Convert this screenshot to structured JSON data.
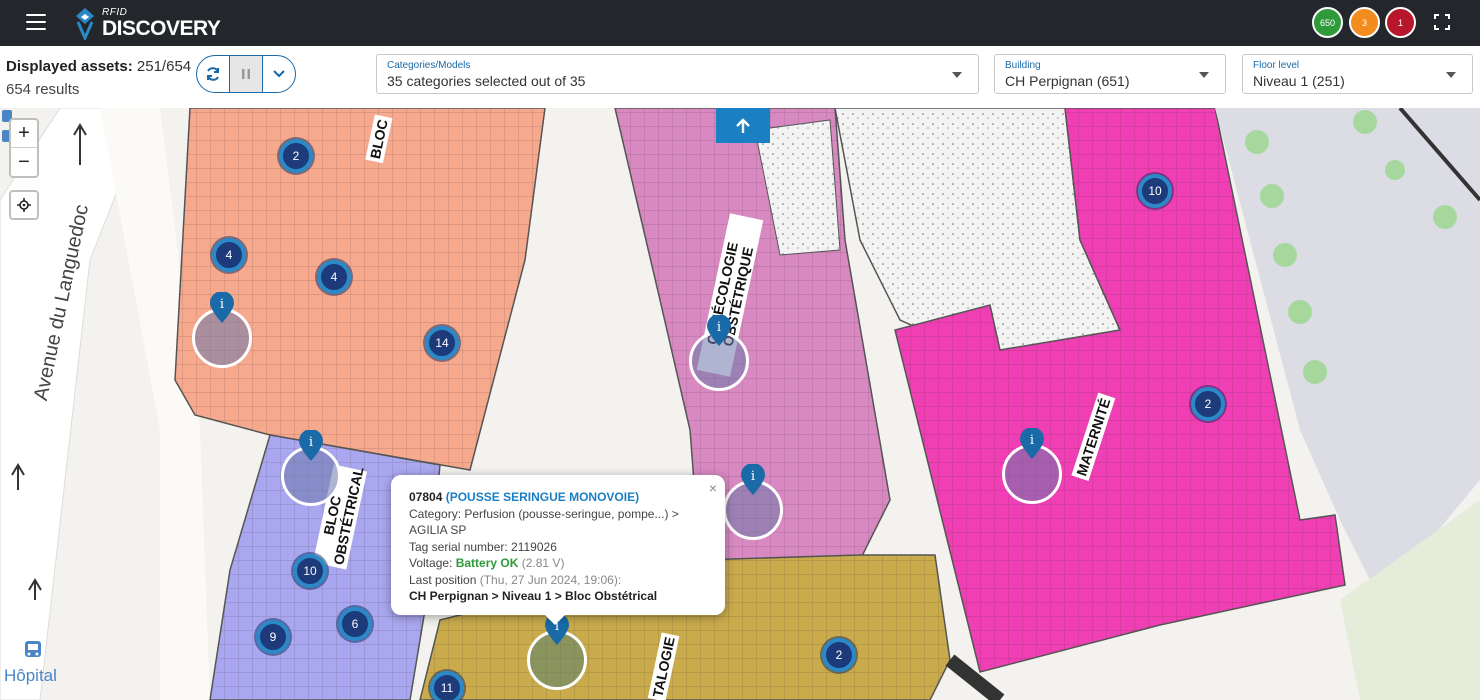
{
  "app": {
    "logo_small": "RFID",
    "logo_big": "DISCOVERY"
  },
  "status": {
    "green": {
      "value": "650",
      "color": "#2f9a3a"
    },
    "orange": {
      "value": "3",
      "color": "#f28c1e"
    },
    "red": {
      "value": "1",
      "color": "#b8172b"
    }
  },
  "toolbar": {
    "displayed_label": "Displayed assets:",
    "displayed_value": "251/654",
    "results": "654 results",
    "categories_label": "Categories/Models",
    "categories_value": "35 categories selected out of 35",
    "building_label": "Building",
    "building_value": "CH Perpignan (651)",
    "floor_label": "Floor level",
    "floor_value": "Niveau 1 (251)"
  },
  "map": {
    "zoom_in": "+",
    "zoom_out": "−",
    "street_name": "Avenue du Languedoc",
    "poi_label": "Hôpital",
    "zone_labels": {
      "bloc_top": "BLOC",
      "gyneco": "GYNÉCOLOGIE OBSTÉTRIQUE",
      "maternite": "MATERNITÉ",
      "bloc_obstetrical": "BLOC OBSTÉTRICAL",
      "talogie": "TALOGIE"
    },
    "clusters": [
      "2",
      "4",
      "4",
      "14",
      "10",
      "2",
      "10",
      "9",
      "6",
      "2",
      "11"
    ]
  },
  "popup": {
    "asset_id": "07804",
    "asset_name": "(POUSSE SERINGUE MONOVOIE)",
    "category": "Category: Perfusion (pousse-seringue, pompe...) >",
    "model": "AGILIA SP",
    "tag_serial": "Tag serial number: 2119026",
    "voltage_label": "Voltage:",
    "battery_status": "Battery OK",
    "voltage_value": "(2.81 V)",
    "last_position_label": "Last position",
    "last_position_time": "(Thu, 27 Jun 2024, 19:06):",
    "location_path": "CH Perpignan > Niveau 1 > Bloc Obstétrical",
    "close": "×"
  },
  "colors": {
    "salmon_zone": "#f7a98e",
    "lavender_zone": "#a9a7f0",
    "mauve_zone": "#d889c2",
    "pink_zone": "#f03fb4",
    "olive_zone": "#c9ab4c",
    "accent": "#1a7fc3"
  }
}
